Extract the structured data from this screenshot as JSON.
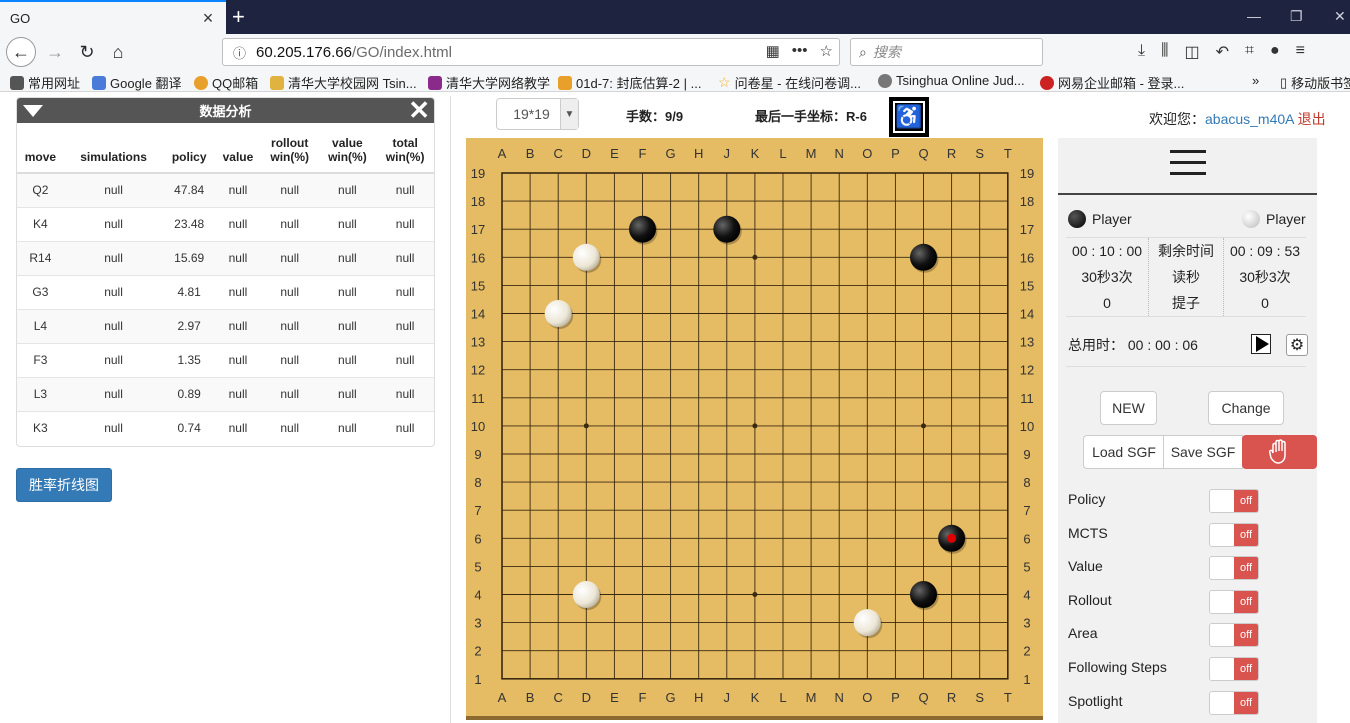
{
  "browser": {
    "tab_title": "GO",
    "tab_close": "×",
    "new_tab": "+",
    "url_host": "60.205.176.66",
    "url_path": "/GO/index.html",
    "search_placeholder": "搜索",
    "bookmarks": [
      {
        "label": "常用网址",
        "color": "#555555"
      },
      {
        "label": "Google 翻译",
        "color": "#4a7bd8"
      },
      {
        "label": "QQ邮箱",
        "color": "#e8a02a"
      },
      {
        "label": "清华大学校园网 Tsin...",
        "color": "#e0b240"
      },
      {
        "label": "清华大学网络教学",
        "color": "#8a2a8a"
      },
      {
        "label": "01d-7: 封底估算-2 | ...",
        "color": "#e8a02a"
      },
      {
        "label": "问卷星 - 在线问卷调...",
        "color": "#f0b020"
      },
      {
        "label": "Tsinghua Online Jud...",
        "color": "#777777"
      },
      {
        "label": "网易企业邮箱 - 登录...",
        "color": "#cc2222"
      },
      {
        "label": "移动版书签",
        "color": "#555555"
      }
    ]
  },
  "analysis": {
    "title": "数据分析",
    "columns": [
      "move",
      "simulations",
      "policy",
      "value",
      "rollout\nwin(%)",
      "value\nwin(%)",
      "total\nwin(%)"
    ],
    "rows": [
      [
        "Q2",
        "null",
        "47.84",
        "null",
        "null",
        "null",
        "null"
      ],
      [
        "K4",
        "null",
        "23.48",
        "null",
        "null",
        "null",
        "null"
      ],
      [
        "R14",
        "null",
        "15.69",
        "null",
        "null",
        "null",
        "null"
      ],
      [
        "G3",
        "null",
        "4.81",
        "null",
        "null",
        "null",
        "null"
      ],
      [
        "L4",
        "null",
        "2.97",
        "null",
        "null",
        "null",
        "null"
      ],
      [
        "F3",
        "null",
        "1.35",
        "null",
        "null",
        "null",
        "null"
      ],
      [
        "L3",
        "null",
        "0.89",
        "null",
        "null",
        "null",
        "null"
      ],
      [
        "K3",
        "null",
        "0.74",
        "null",
        "null",
        "null",
        "null"
      ]
    ],
    "winrate_button": "胜率折线图"
  },
  "header": {
    "board_size": "19*19",
    "moves_label": "手数：9/9",
    "last_move_label": "最后一手坐标：R-6",
    "welcome": "欢迎您：",
    "username": "abacus_m40A",
    "logout": "退出"
  },
  "board": {
    "size": 19,
    "columns": [
      "A",
      "B",
      "C",
      "D",
      "E",
      "F",
      "G",
      "H",
      "J",
      "K",
      "L",
      "M",
      "N",
      "O",
      "P",
      "Q",
      "R",
      "S",
      "T"
    ],
    "stones": [
      {
        "color": "black",
        "pos": "F17"
      },
      {
        "color": "black",
        "pos": "J17"
      },
      {
        "color": "black",
        "pos": "Q16"
      },
      {
        "color": "black",
        "pos": "R6",
        "last": true
      },
      {
        "color": "black",
        "pos": "Q4"
      },
      {
        "color": "white",
        "pos": "D16"
      },
      {
        "color": "white",
        "pos": "C14"
      },
      {
        "color": "white",
        "pos": "D4"
      },
      {
        "color": "white",
        "pos": "O3"
      }
    ],
    "colors": {
      "wood": "#e5bb63",
      "line": "#3a2a10",
      "last_marker": "#e00000"
    }
  },
  "side": {
    "black_player": "Player",
    "white_player": "Player",
    "black_time": "00 : 10 : 00",
    "time_label": "剩余时间",
    "white_time": "00 : 09 : 53",
    "black_byoyomi": "30秒3次",
    "byoyomi_label": "读秒",
    "white_byoyomi": "30秒3次",
    "black_captures": "0",
    "captures_label": "提子",
    "white_captures": "0",
    "total_label": "总用时：",
    "total_time": "00 : 00 : 06",
    "new_button": "NEW",
    "change_button": "Change",
    "load_button": "Load SGF",
    "save_button": "Save SGF",
    "toggles": [
      {
        "label": "Policy",
        "state": "off"
      },
      {
        "label": "MCTS",
        "state": "off"
      },
      {
        "label": "Value",
        "state": "off"
      },
      {
        "label": "Rollout",
        "state": "off"
      },
      {
        "label": "Area",
        "state": "off"
      },
      {
        "label": "Following Steps",
        "state": "off"
      },
      {
        "label": "Spotlight",
        "state": "off"
      }
    ]
  }
}
